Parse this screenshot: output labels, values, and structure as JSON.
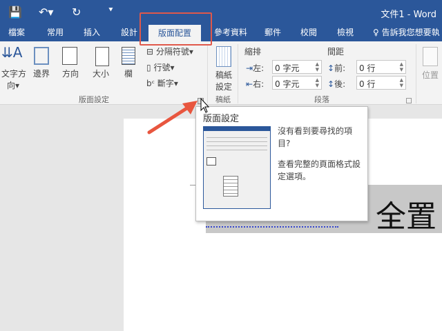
{
  "window": {
    "title": "文件1 - Word"
  },
  "quick_access": {
    "icons": [
      "save-icon",
      "undo-icon",
      "redo-icon",
      "customize-icon"
    ]
  },
  "tabs": [
    "檔案",
    "常用",
    "插入",
    "設計",
    "版面配置",
    "參考資料",
    "郵件",
    "校閱",
    "檢視"
  ],
  "active_tab": "版面配置",
  "tell_me": "告訴我您想要執",
  "ribbon": {
    "page_setup": {
      "text_direction": "文字方",
      "text_direction2": "向",
      "margins": "邊界",
      "orientation": "方向",
      "size": "大小",
      "columns": "欄",
      "breaks": "分隔符號",
      "line_numbers": "行號",
      "hyphenation": "斷字",
      "group": "版面設定"
    },
    "manuscript": {
      "label1": "稿紙",
      "label2": "設定",
      "group": "稿紙"
    },
    "paragraph": {
      "indent": "縮排",
      "spacing": "間距",
      "left": "左:",
      "right": "右:",
      "before": "前:",
      "after": "後:",
      "left_val": "0 字元",
      "right_val": "0 字元",
      "before_val": "0 行",
      "after_val": "0 行",
      "group": "段落"
    },
    "arrange": {
      "position": "位置"
    }
  },
  "document": {
    "text": "全置"
  },
  "tooltip": {
    "title": "版面設定",
    "line1": "沒有看到要尋找的項目?",
    "line2": "查看完整的頁面格式設定選項。"
  },
  "colors": {
    "accent": "#2b579a",
    "highlight_box": "#e0584a",
    "arrow": "#e8563f"
  }
}
